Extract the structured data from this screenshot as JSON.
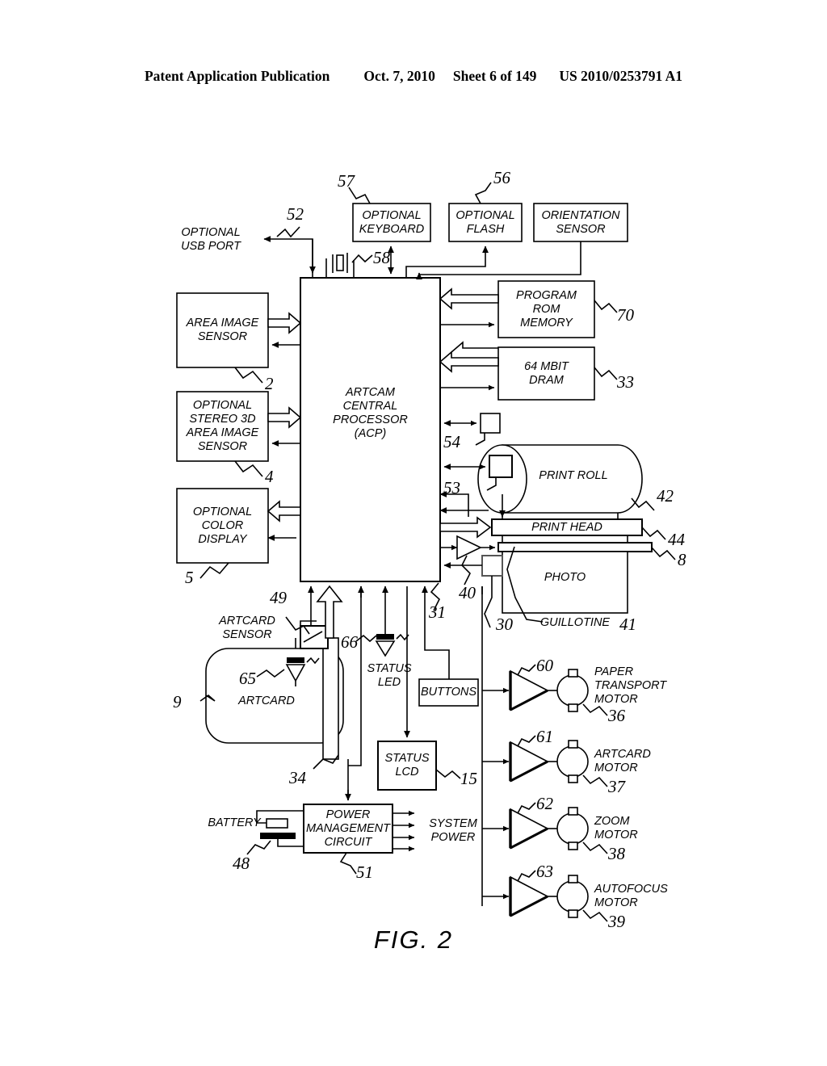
{
  "header": {
    "publication": "Patent Application Publication",
    "date": "Oct. 7, 2010",
    "sheet": "Sheet 6 of 149",
    "docnum": "US 2010/0253791 A1"
  },
  "figure": {
    "caption": "FIG. 2"
  },
  "blocks": {
    "optional_keyboard": "OPTIONAL\nKEYBOARD",
    "optional_flash": "OPTIONAL\nFLASH",
    "orientation_sensor": "ORIENTATION\nSENSOR",
    "optional_usb_port": "OPTIONAL\nUSB PORT",
    "area_image_sensor": "AREA IMAGE\nSENSOR",
    "stereo_sensor": "OPTIONAL\nSTEREO 3D\nAREA IMAGE\nSENSOR",
    "color_display": "OPTIONAL\nCOLOR\nDISPLAY",
    "acp": "ARTCAM\nCENTRAL\nPROCESSOR\n(ACP)",
    "program_rom": "PROGRAM\nROM\nMEMORY",
    "dram": "64 MBIT\nDRAM",
    "print_roll": "PRINT ROLL",
    "print_head": "PRINT HEAD",
    "photo": "PHOTO",
    "guillotine": "GUILLOTINE",
    "artcard_sensor": "ARTCARD\nSENSOR",
    "artcard": "ARTCARD",
    "status_led": "STATUS\nLED",
    "buttons": "BUTTONS",
    "status_lcd": "STATUS\nLCD",
    "battery": "BATTERY",
    "power_mgmt": "POWER\nMANAGEMENT\nCIRCUIT",
    "system_power": "SYSTEM\nPOWER",
    "paper_transport_motor": "PAPER\nTRANSPORT\nMOTOR",
    "artcard_motor": "ARTCARD\nMOTOR",
    "zoom_motor": "ZOOM\nMOTOR",
    "autofocus_motor": "AUTOFOCUS\nMOTOR"
  },
  "reference_numerals": {
    "n2": "2",
    "n4": "4",
    "n5": "5",
    "n8": "8",
    "n9": "9",
    "n15": "15",
    "n30": "30",
    "n31": "31",
    "n33": "33",
    "n34": "34",
    "n36": "36",
    "n37": "37",
    "n38": "38",
    "n39": "39",
    "n40": "40",
    "n41": "41",
    "n42": "42",
    "n44": "44",
    "n48": "48",
    "n49": "49",
    "n51": "51",
    "n52": "52",
    "n53": "53",
    "n54": "54",
    "n56": "56",
    "n57": "57",
    "n58": "58",
    "n60": "60",
    "n61": "61",
    "n62": "62",
    "n63": "63",
    "n65": "65",
    "n66": "66",
    "n70": "70"
  },
  "colors": {
    "line": "#000000",
    "background": "#ffffff"
  }
}
